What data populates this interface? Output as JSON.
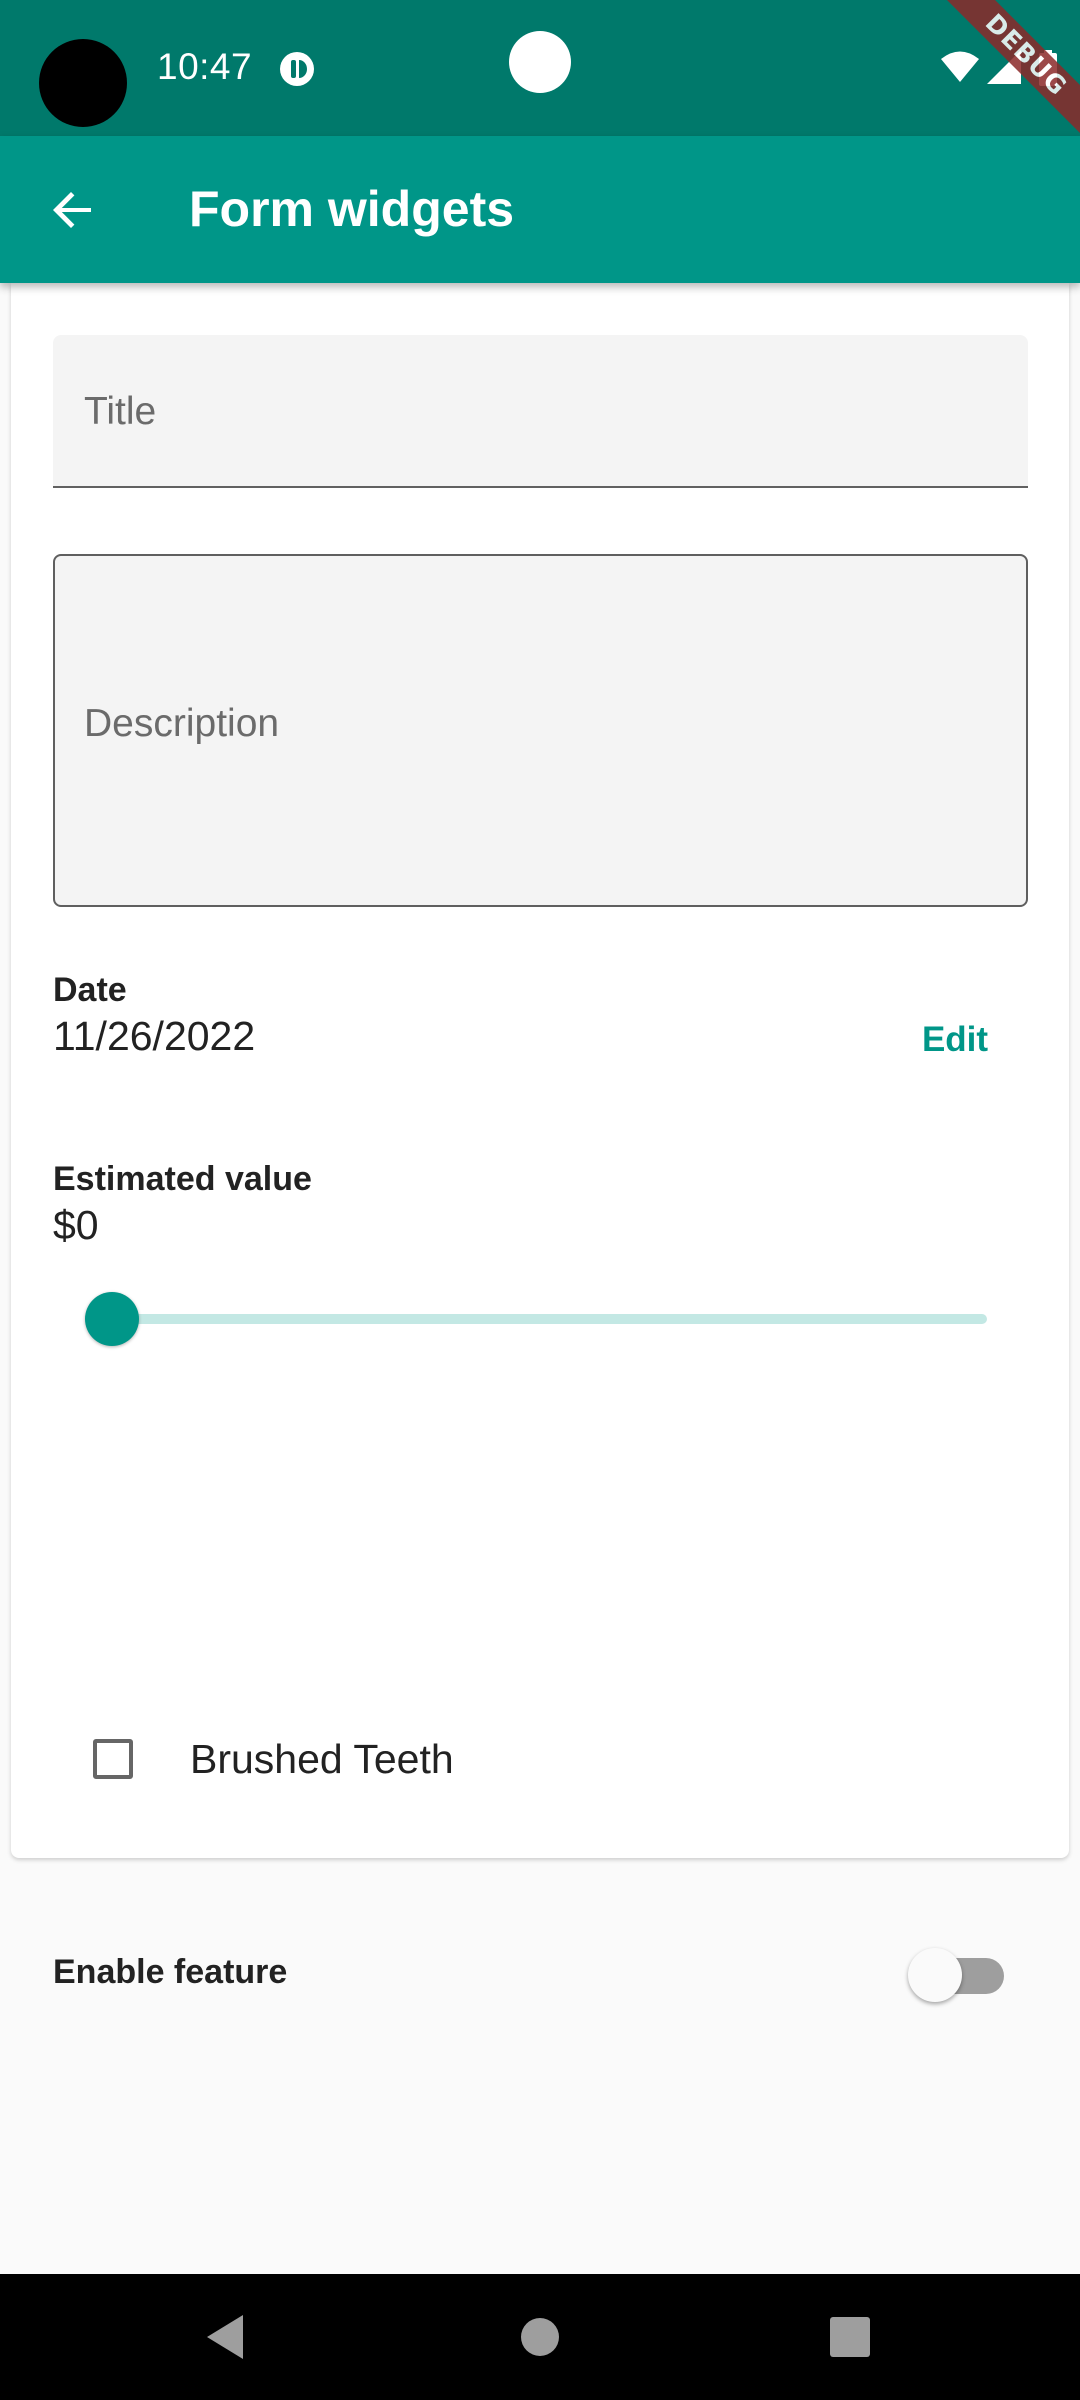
{
  "status_bar": {
    "time": "10:47",
    "debug_banner": "DEBUG",
    "icons": [
      "notification-icon",
      "wifi-icon",
      "signal-icon",
      "battery-icon"
    ],
    "color": "#00796B"
  },
  "app_bar": {
    "title": "Form widgets",
    "back_icon": "arrow-back-icon",
    "color": "#009688"
  },
  "form": {
    "title_field": {
      "placeholder": "Title",
      "value": ""
    },
    "description_field": {
      "placeholder": "Description",
      "value": ""
    },
    "date": {
      "label": "Date",
      "value": "11/26/2022",
      "edit_label": "Edit"
    },
    "estimated_value": {
      "label": "Estimated value",
      "value": "$0",
      "slider_fraction": 0
    },
    "checkbox": {
      "label": "Brushed Teeth",
      "checked": false
    },
    "feature_toggle": {
      "label": "Enable feature",
      "enabled": false
    }
  },
  "nav_bar": {
    "buttons": [
      "back-triangle-icon",
      "home-circle-icon",
      "recents-square-icon"
    ]
  },
  "colors": {
    "accent": "#009688",
    "status_bar": "#00796B",
    "slider_track": "#C3E8E4"
  }
}
